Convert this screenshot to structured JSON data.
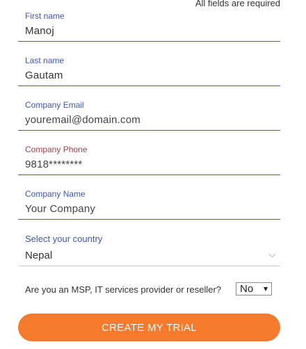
{
  "form": {
    "required_note": "All fields are required",
    "first_name": {
      "label": "First name",
      "value": "Manoj"
    },
    "last_name": {
      "label": "Last name",
      "value": "Gautam"
    },
    "email": {
      "label": "Company Email",
      "placeholder": "youremail@domain.com"
    },
    "phone": {
      "label": "Company Phone",
      "placeholder": "9818********"
    },
    "company": {
      "label": "Company Name",
      "placeholder": "Your Company"
    },
    "country": {
      "label": "Select your country",
      "selected": "Nepal"
    },
    "msp": {
      "question": "Are you an MSP, IT services provider or reseller?",
      "selected": "No"
    },
    "submit_label": "CREATE MY TRIAL"
  },
  "colors": {
    "label_blue": "#3f56b5",
    "label_error": "#a0424e",
    "underline": "#4a5aa8",
    "cta": "#f47a2d"
  }
}
